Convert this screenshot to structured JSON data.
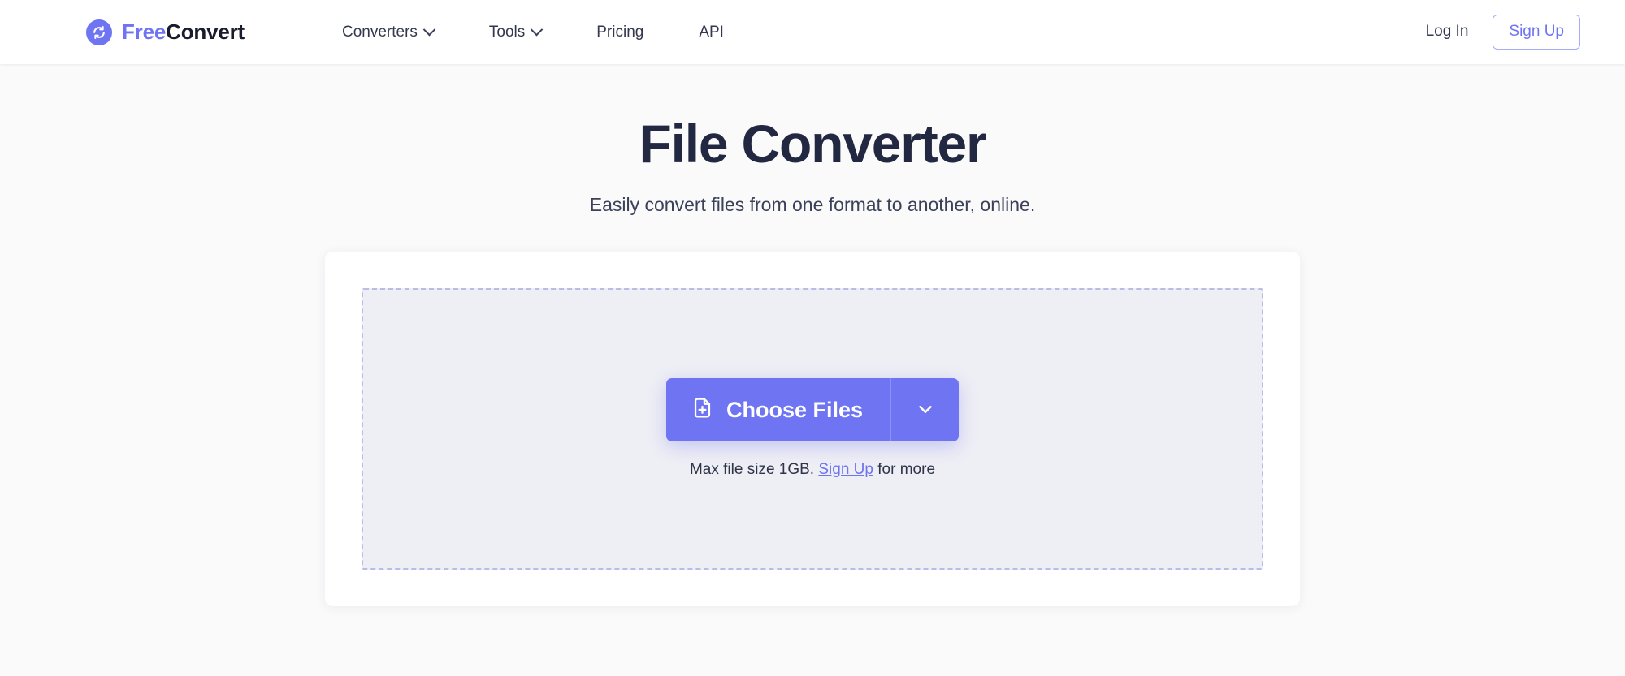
{
  "header": {
    "brand": {
      "icon": "sync-circle-icon",
      "text_primary": "Free",
      "text_secondary": "Convert"
    },
    "nav": [
      {
        "label": "Converters",
        "has_dropdown": true,
        "icon": "chevron-down-icon"
      },
      {
        "label": "Tools",
        "has_dropdown": true,
        "icon": "chevron-down-icon"
      },
      {
        "label": "Pricing",
        "has_dropdown": false,
        "icon": ""
      },
      {
        "label": "API",
        "has_dropdown": false,
        "icon": ""
      }
    ],
    "login_label": "Log In",
    "signup_label": "Sign Up"
  },
  "hero": {
    "title": "File Converter",
    "subtitle": "Easily convert files from one format to another, online."
  },
  "uploader": {
    "choose_files_label": "Choose Files",
    "choose_files_icon": "file-add-icon",
    "dropdown_icon": "chevron-down-icon",
    "max_size_prefix": "Max file size 1GB.",
    "max_size_link": "Sign Up",
    "max_size_suffix": "for more"
  },
  "colors": {
    "accent": "#6e74f2",
    "heading": "#232842",
    "page_background": "#fafafb",
    "dropzone_fill": "#eeeef5",
    "dropzone_border": "#b9bce4"
  }
}
